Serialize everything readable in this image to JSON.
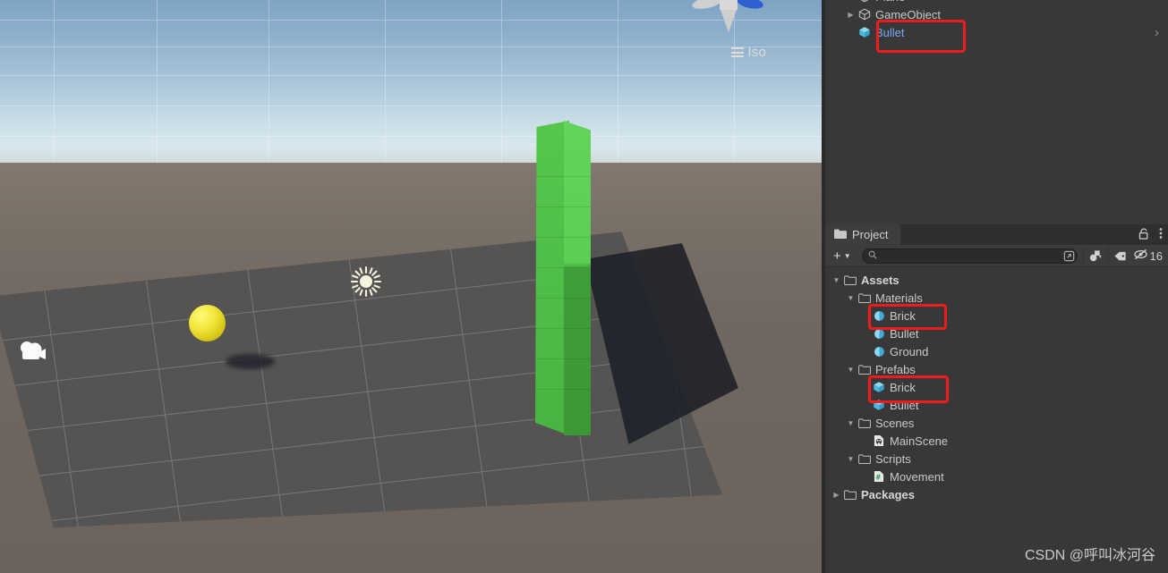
{
  "app": "Unity Editor",
  "scene_view": {
    "iso_label": "Iso",
    "gizmo_icon": "scene-orientation-gizmo",
    "objects": [
      {
        "name": "brick-wall",
        "color": "#4fbe47",
        "kind": "green stacked cube wall"
      },
      {
        "name": "bullet-sphere",
        "color": "#f3e63c",
        "kind": "yellow sphere"
      },
      {
        "name": "ground-plane",
        "color": "#555453",
        "kind": "dark grey plane"
      },
      {
        "name": "main-camera-gizmo",
        "icon": "camera-icon"
      },
      {
        "name": "directional-light-gizmo",
        "icon": "sun-icon"
      }
    ]
  },
  "hierarchy": {
    "rows": [
      {
        "label": "Plane",
        "icon": "cube-icon",
        "indent": 1,
        "twisty": "",
        "selected": false,
        "partial": true
      },
      {
        "label": "GameObject",
        "icon": "cube-icon",
        "indent": 1,
        "twisty": "▶",
        "selected": false
      },
      {
        "label": "Bullet",
        "icon": "prefab-cube-icon",
        "indent": 1,
        "twisty": "",
        "selected": true
      }
    ],
    "overflow_icon": "chevron-right-icon"
  },
  "project": {
    "tab_label": "Project",
    "tab_icon": "folder-icon",
    "lock_icon": "lock-icon",
    "menu_icon": "kebab-menu-icon",
    "create_label": "+",
    "create_dropdown_icon": "chevron-down-icon",
    "search_placeholder": "",
    "search_value": "",
    "search_icon": "search-icon",
    "search_expand_icon": "expand-icon",
    "icon_buttons": [
      {
        "name": "object-picker-icon"
      },
      {
        "name": "label-tag-icon"
      }
    ],
    "hidden_count": "16",
    "hidden_icon": "eye-slash-icon",
    "tree": [
      {
        "label": "Assets",
        "icon": "folder-icon",
        "indent": 0,
        "twisty": "▼",
        "bold": true
      },
      {
        "label": "Materials",
        "icon": "folder-icon",
        "indent": 1,
        "twisty": "▼",
        "bold": false
      },
      {
        "label": "Brick",
        "icon": "material-icon",
        "indent": 2,
        "twisty": "",
        "bold": false
      },
      {
        "label": "Bullet",
        "icon": "material-icon",
        "indent": 2,
        "twisty": "",
        "bold": false
      },
      {
        "label": "Ground",
        "icon": "material-icon",
        "indent": 2,
        "twisty": "",
        "bold": false
      },
      {
        "label": "Prefabs",
        "icon": "folder-icon",
        "indent": 1,
        "twisty": "▼",
        "bold": false
      },
      {
        "label": "Brick",
        "icon": "prefab-cube-icon",
        "indent": 2,
        "twisty": "",
        "bold": false
      },
      {
        "label": "Bullet",
        "icon": "prefab-cube-icon",
        "indent": 2,
        "twisty": "",
        "bold": false
      },
      {
        "label": "Scenes",
        "icon": "folder-icon",
        "indent": 1,
        "twisty": "▼",
        "bold": false
      },
      {
        "label": "MainScene",
        "icon": "scene-icon",
        "indent": 2,
        "twisty": "",
        "bold": false
      },
      {
        "label": "Scripts",
        "icon": "folder-icon",
        "indent": 1,
        "twisty": "▼",
        "bold": false
      },
      {
        "label": "Movement",
        "icon": "csharp-script-icon",
        "indent": 2,
        "twisty": "",
        "bold": false
      },
      {
        "label": "Packages",
        "icon": "folder-icon",
        "indent": 0,
        "twisty": "▶",
        "bold": true
      }
    ]
  },
  "annotations": {
    "color": "#ef1c1c",
    "boxes": [
      {
        "target": "hierarchy-bullet-row"
      },
      {
        "target": "project-materials-brick"
      },
      {
        "target": "project-prefabs-brick"
      }
    ]
  },
  "watermark": {
    "text": "CSDN @呼叫冰河谷"
  }
}
